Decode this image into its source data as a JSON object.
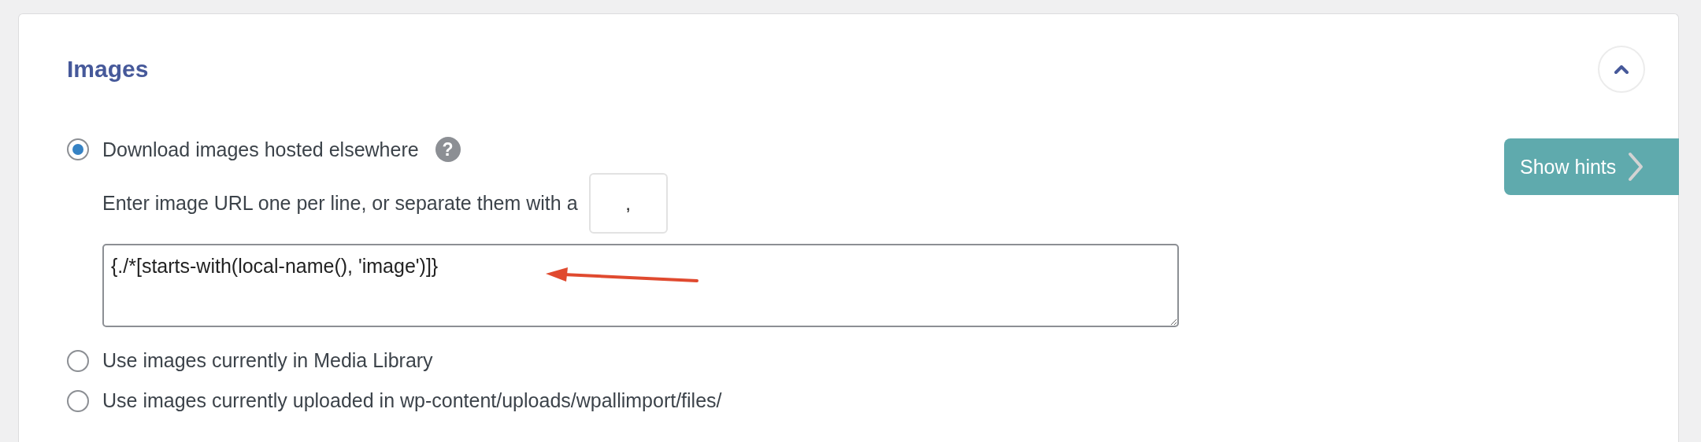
{
  "section": {
    "title": "Images",
    "expanded": true
  },
  "options": [
    {
      "label": "Download images hosted elsewhere",
      "selected": true,
      "help": "?"
    },
    {
      "label": "Use images currently in Media Library",
      "selected": false
    },
    {
      "label": "Use images currently uploaded in wp-content/uploads/wpallimport/files/",
      "selected": false
    }
  ],
  "url_hint": "Enter image URL one per line, or separate them with a",
  "separator": {
    "value": ","
  },
  "url_field": {
    "value": "{./*[starts-with(local-name(), 'image')]}"
  },
  "hints_button": {
    "label": "Show hints"
  }
}
